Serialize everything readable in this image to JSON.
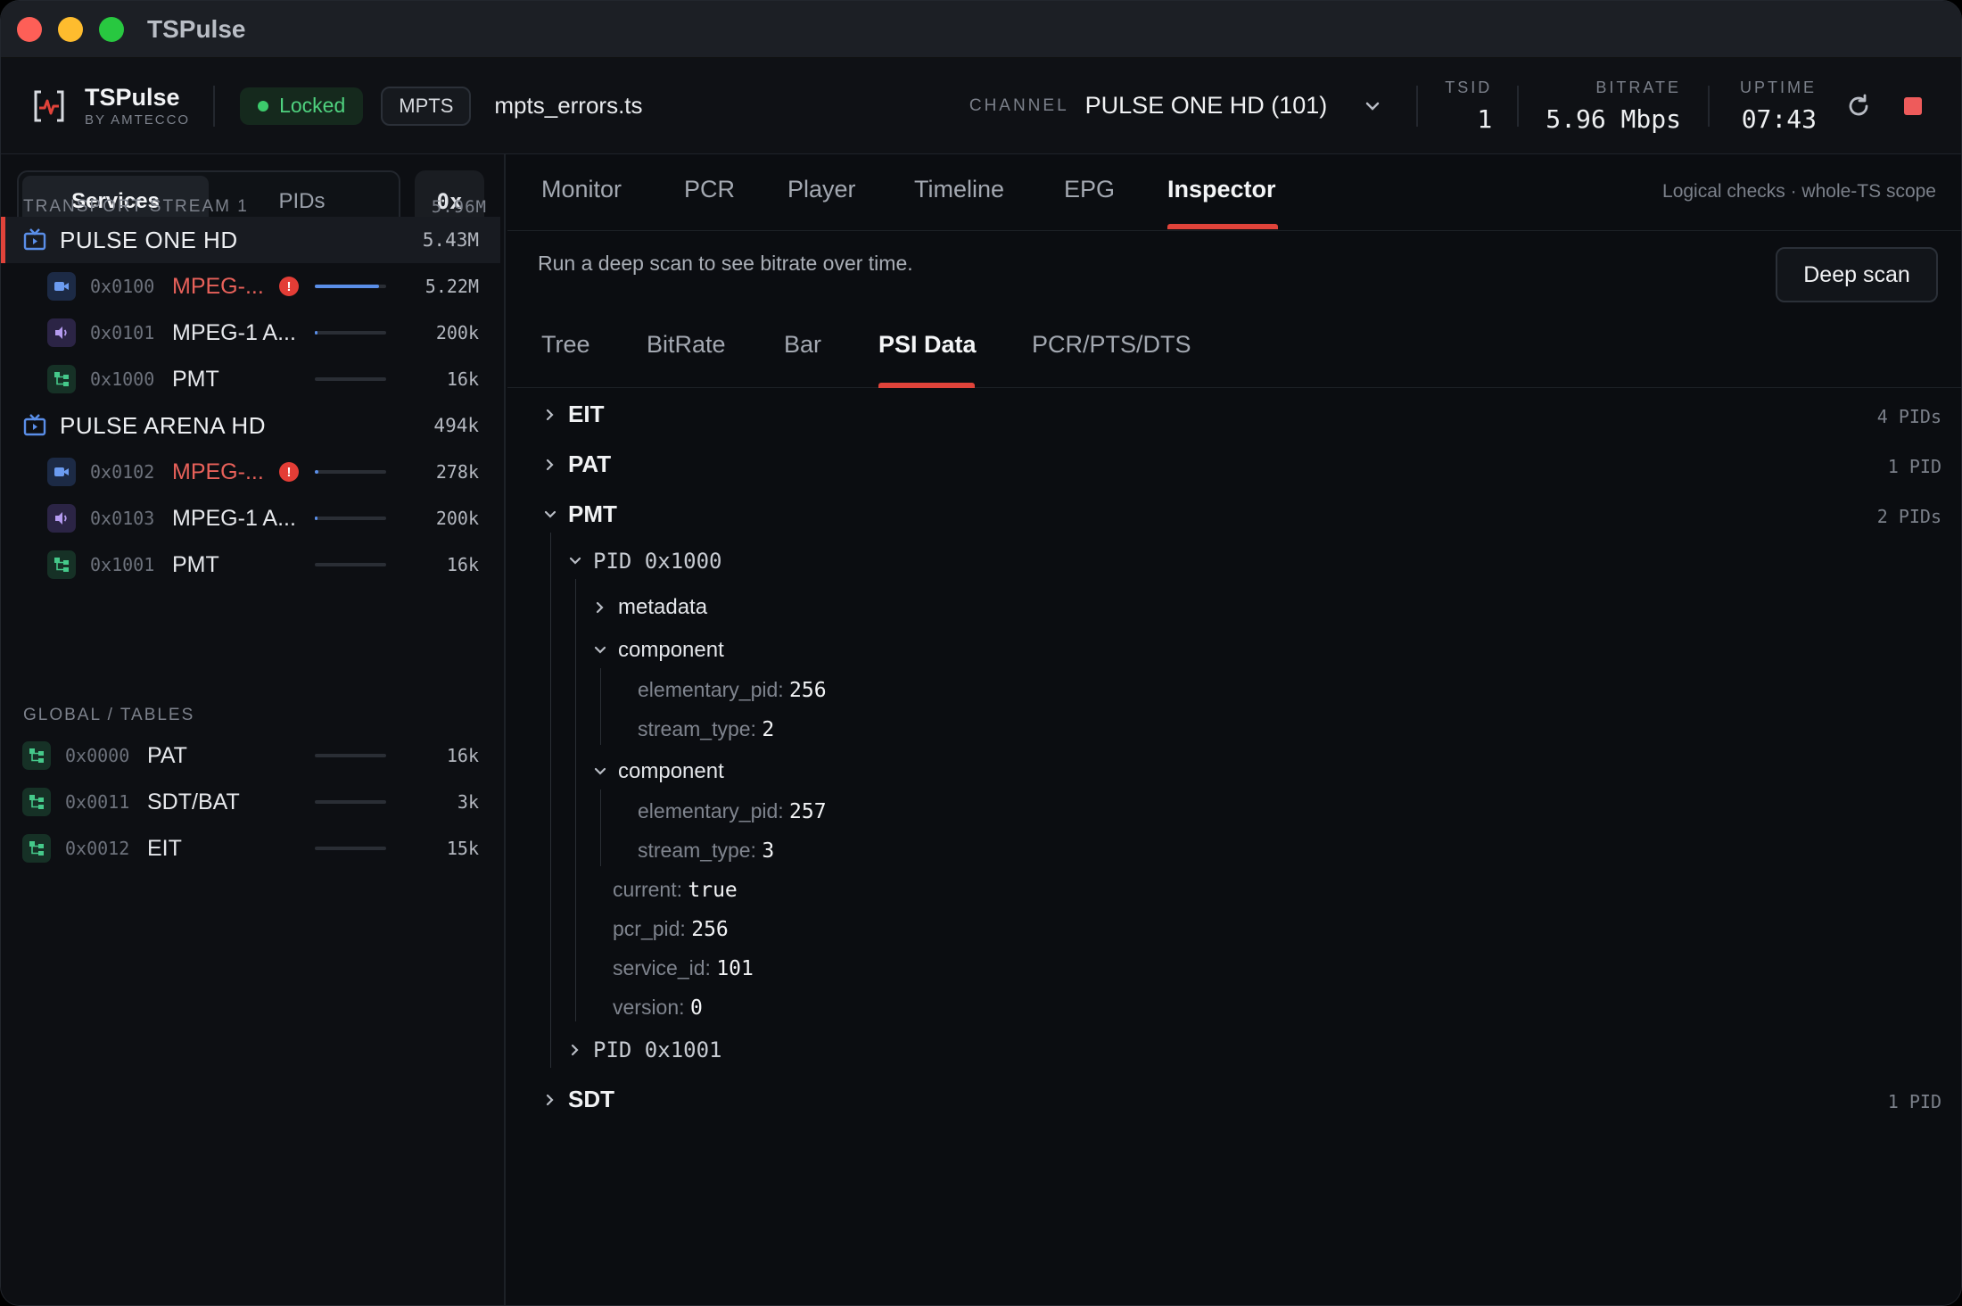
{
  "window": {
    "title": "TSPulse"
  },
  "header": {
    "brand_name": "TSPulse",
    "brand_sub": "BY AMTECCO",
    "status": "Locked",
    "format": "MPTS",
    "file": "mpts_errors.ts",
    "channel_label": "CHANNEL",
    "channel_value": "PULSE ONE HD (101)",
    "tsid_label": "TSID",
    "tsid_value": "1",
    "bitrate_label": "BITRATE",
    "bitrate_value": "5.96 Mbps",
    "uptime_label": "UPTIME",
    "uptime_value": "07:43"
  },
  "sidebar": {
    "seg_services": "Services",
    "seg_pids": "PIDs",
    "hex_toggle": "0x",
    "ts_label": "TRANSPORT STREAM 1",
    "ts_rate": "5.96M",
    "global_label": "GLOBAL / TABLES",
    "services": [
      {
        "name": "PULSE ONE HD",
        "rate": "5.43M",
        "pids": [
          {
            "hex": "0x0100",
            "name": "MPEG-...",
            "type": "video",
            "error": true,
            "load": 0.9,
            "rate": "5.22M"
          },
          {
            "hex": "0x0101",
            "name": "MPEG-1 A...",
            "type": "audio",
            "error": false,
            "load": 0.04,
            "rate": "200k"
          },
          {
            "hex": "0x1000",
            "name": "PMT",
            "type": "table",
            "error": false,
            "load": 0,
            "rate": "16k"
          }
        ]
      },
      {
        "name": "PULSE ARENA HD",
        "rate": "494k",
        "pids": [
          {
            "hex": "0x0102",
            "name": "MPEG-...",
            "type": "video",
            "error": true,
            "load": 0.05,
            "rate": "278k"
          },
          {
            "hex": "0x0103",
            "name": "MPEG-1 A...",
            "type": "audio",
            "error": false,
            "load": 0.04,
            "rate": "200k"
          },
          {
            "hex": "0x1001",
            "name": "PMT",
            "type": "table",
            "error": false,
            "load": 0,
            "rate": "16k"
          }
        ]
      }
    ],
    "globals": [
      {
        "hex": "0x0000",
        "name": "PAT",
        "rate": "16k"
      },
      {
        "hex": "0x0011",
        "name": "SDT/BAT",
        "rate": "3k"
      },
      {
        "hex": "0x0012",
        "name": "EIT",
        "rate": "15k"
      }
    ]
  },
  "main": {
    "tabs": [
      "Monitor",
      "PCR",
      "Player",
      "Timeline",
      "EPG",
      "Inspector"
    ],
    "active_tab": "Inspector",
    "tabs_note": "Logical checks · whole-TS scope",
    "scan_message": "Run a deep scan to see bitrate over time.",
    "deep_scan_label": "Deep scan",
    "subtabs": [
      "Tree",
      "BitRate",
      "Bar",
      "PSI Data",
      "PCR/PTS/DTS"
    ],
    "active_subtab": "PSI Data",
    "tree": {
      "eit": {
        "label": "EIT",
        "count": "4 PIDs"
      },
      "pat": {
        "label": "PAT",
        "count": "1 PID"
      },
      "pmt": {
        "label": "PMT",
        "count": "2 PIDs"
      },
      "pid_1000": "PID 0x1000",
      "metadata": "metadata",
      "component_1": "component",
      "component_2": "component",
      "c1_elementary_pid": {
        "k": "elementary_pid:",
        "v": "256"
      },
      "c1_stream_type": {
        "k": "stream_type:",
        "v": "2"
      },
      "c2_elementary_pid": {
        "k": "elementary_pid:",
        "v": "257"
      },
      "c2_stream_type": {
        "k": "stream_type:",
        "v": "3"
      },
      "current": {
        "k": "current:",
        "v": "true"
      },
      "pcr_pid": {
        "k": "pcr_pid:",
        "v": "256"
      },
      "service_id": {
        "k": "service_id:",
        "v": "101"
      },
      "version": {
        "k": "version:",
        "v": "0"
      },
      "pid_1001": "PID 0x1001",
      "sdt": {
        "label": "SDT",
        "count": "1 PID"
      }
    }
  },
  "colors": {
    "accent": "#e0433a",
    "ok": "#3ccb6c",
    "video": "#5a8ee8",
    "audio": "#a58ae6",
    "table": "#45c98a"
  },
  "icons": [
    "tv-icon",
    "video-icon",
    "speaker-icon",
    "table-icon",
    "alert-icon",
    "chevron-down-icon",
    "chevron-right-icon",
    "refresh-icon",
    "stop-icon",
    "logo-icon"
  ]
}
